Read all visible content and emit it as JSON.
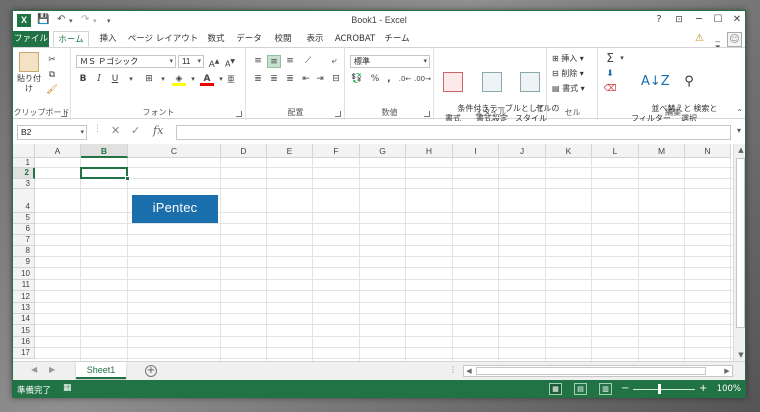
{
  "window": {
    "title": "Book1 - Excel",
    "app_icon_letter": "X",
    "help_label": "?",
    "minimize_label": "─",
    "maximize_label": "☐",
    "close_label": "✕",
    "ribbon_display_label": "⊡"
  },
  "quick_access": {
    "save_label": "💾",
    "undo_label": "↶",
    "redo_label": "↷",
    "customize_label": "▾"
  },
  "tabs": [
    {
      "label": "ファイル"
    },
    {
      "label": "ホーム"
    },
    {
      "label": "挿入"
    },
    {
      "label": "ページ レイアウト"
    },
    {
      "label": "数式"
    },
    {
      "label": "データ"
    },
    {
      "label": "校閲"
    },
    {
      "label": "表示"
    },
    {
      "label": "ACROBAT"
    },
    {
      "label": "チーム"
    }
  ],
  "ribbon": {
    "clipboard": {
      "label": "クリップボード",
      "paste_label": "貼り付け"
    },
    "font": {
      "label": "フォント",
      "name": "ＭＳ Ｐゴシック",
      "size": "11",
      "bold": "B",
      "italic": "I",
      "underline": "U"
    },
    "alignment": {
      "label": "配置"
    },
    "number": {
      "label": "数値",
      "format": "標準",
      "percent": "%",
      "comma": ","
    },
    "styles": {
      "label": "スタイル",
      "conditional_label": "条件付き\n書式",
      "table_label": "テーブルとして\n書式設定",
      "cell_styles_label": "セルの\nスタイル"
    },
    "cells": {
      "label": "セル",
      "insert_label": "挿入",
      "delete_label": "削除",
      "format_label": "書式"
    },
    "editing": {
      "label": "編集",
      "sort_label": "並べ替えと\nフィルター",
      "find_label": "検索と\n選択"
    }
  },
  "formula_bar": {
    "name_box": "B2",
    "fx_label": "fx",
    "cancel_label": "✕",
    "enter_label": "✓",
    "formula": ""
  },
  "columns": [
    "A",
    "B",
    "C",
    "D",
    "E",
    "F",
    "G",
    "H",
    "I",
    "J",
    "K",
    "L",
    "M",
    "N"
  ],
  "rows": [
    "1",
    "2",
    "3",
    "4",
    "5",
    "6",
    "7",
    "8",
    "9",
    "10",
    "11",
    "12",
    "13",
    "14",
    "15",
    "16",
    "17"
  ],
  "selected_cell": {
    "column": "B",
    "row": "2"
  },
  "image": {
    "text": "iPentec",
    "color": "#1b6fad"
  },
  "sheets": [
    {
      "name": "Sheet1"
    }
  ],
  "add_sheet_label": "+",
  "status": {
    "ready_text": "準備完了",
    "zoom": "100%",
    "zoom_out": "−",
    "zoom_in": "+"
  },
  "colors": {
    "accent": "#217346",
    "tab_selected": "#207245"
  }
}
